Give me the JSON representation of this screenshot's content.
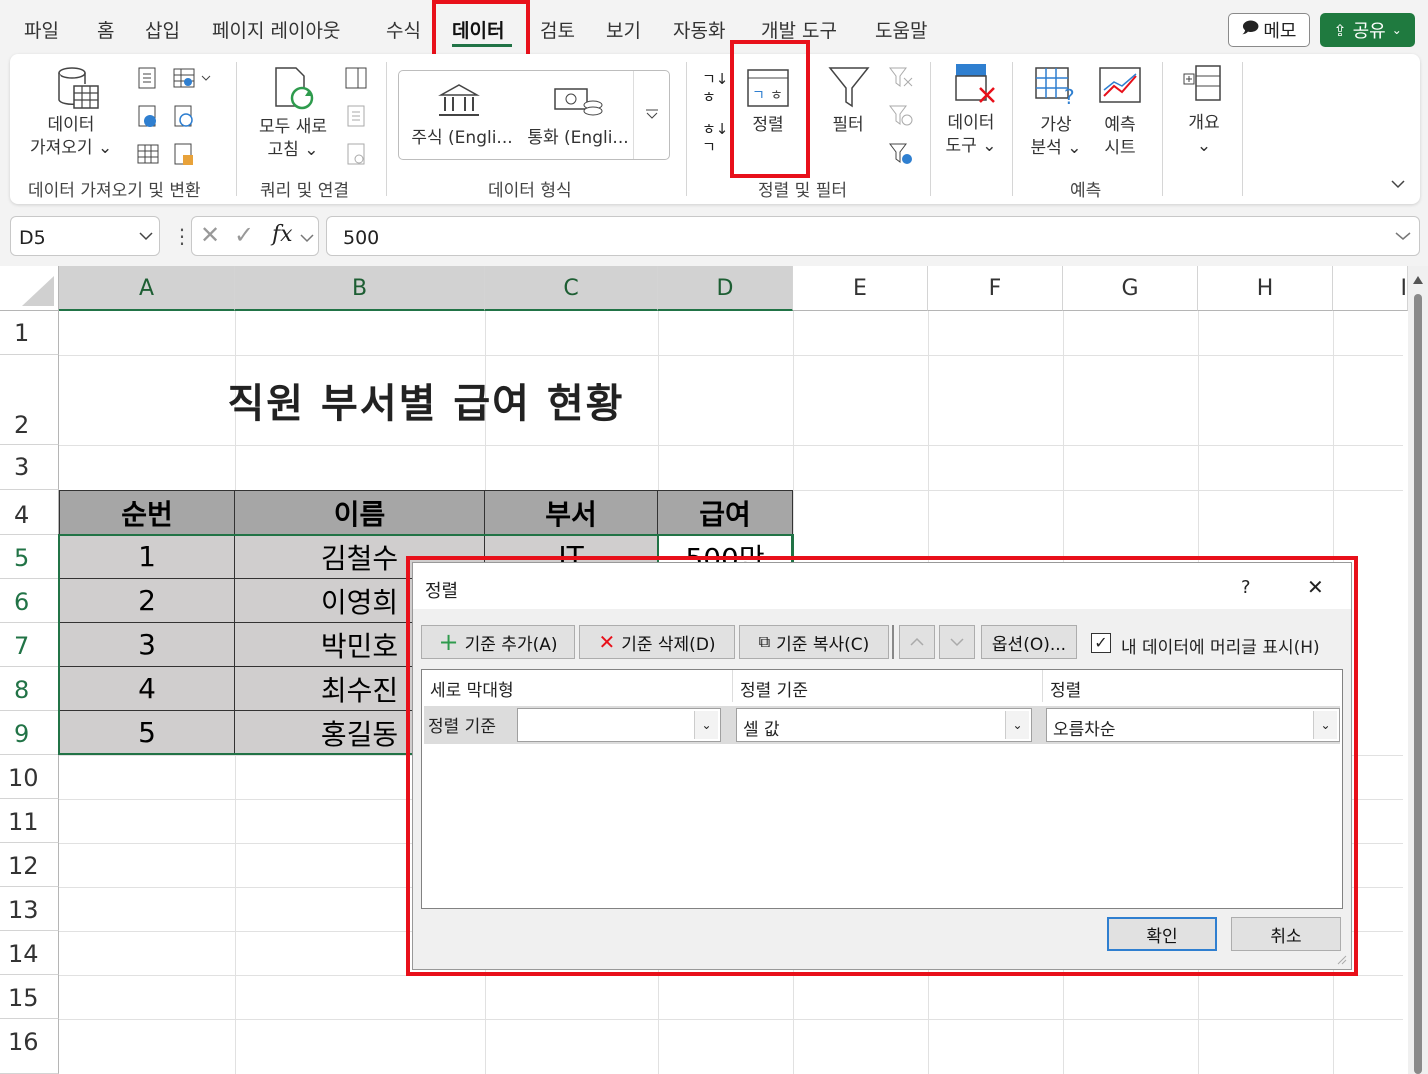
{
  "menu": {
    "tabs": [
      "파일",
      "홈",
      "삽입",
      "페이지 레이아웃",
      "수식",
      "데이터",
      "검토",
      "보기",
      "자동화",
      "개발 도구",
      "도움말"
    ],
    "active": "데이터",
    "memo": "메모",
    "share": "공유"
  },
  "ribbon": {
    "get_data_line1": "데이터",
    "get_data_line2": "가져오기 ⌄",
    "group_get": "데이터 가져오기 및 변환",
    "refresh_line1": "모두 새로",
    "refresh_line2": "고침 ⌄",
    "group_query": "쿼리 및 연결",
    "stocks": "주식 (Engli...",
    "currency": "통화 (Engli...",
    "group_types": "데이터 형식",
    "sort": "정렬",
    "filter": "필터",
    "group_sort": "정렬 및 필터",
    "datatools_line1": "데이터",
    "datatools_line2": "도구 ⌄",
    "whatif_line1": "가상",
    "whatif_line2": "분석 ⌄",
    "forecast_line1": "예측",
    "forecast_line2": "시트",
    "group_forecast": "예측",
    "outline": "개요",
    "outline_arrow": "⌄"
  },
  "formula_bar": {
    "name_box": "D5",
    "formula": "500"
  },
  "sheet": {
    "columns": [
      "A",
      "B",
      "C",
      "D",
      "E",
      "F",
      "G",
      "H",
      "I"
    ],
    "rows": [
      "1",
      "2",
      "3",
      "4",
      "5",
      "6",
      "7",
      "8",
      "9",
      "10",
      "11",
      "12",
      "13",
      "14",
      "15",
      "16"
    ],
    "title": "직원 부서별 급여 현황",
    "headers": [
      "순번",
      "이름",
      "부서",
      "급여"
    ],
    "data": [
      [
        "1",
        "김철수",
        "IT",
        "500만"
      ],
      [
        "2",
        "이영희"
      ],
      [
        "3",
        "박민호"
      ],
      [
        "4",
        "최수진"
      ],
      [
        "5",
        "홍길동"
      ]
    ]
  },
  "dialog": {
    "title": "정렬",
    "help": "?",
    "close": "✕",
    "add_level": "기준 추가(A)",
    "delete_level": "기준 삭제(D)",
    "copy_level": "기준 복사(C)",
    "options": "옵션(O)...",
    "has_headers": "내 데이터에 머리글 표시(H)",
    "has_headers_checked": true,
    "col_header_column": "세로 막대형",
    "col_header_sorton": "정렬 기준",
    "col_header_order": "정렬",
    "row_label": "정렬 기준",
    "column_value": "",
    "sorton_value": "셀 값",
    "order_value": "오름차순",
    "ok": "확인",
    "cancel": "취소"
  },
  "colors": {
    "accent": "#217346",
    "highlight": "#e8101a",
    "header_fill": "#a6a6a6",
    "data_fill": "#d0cece"
  }
}
